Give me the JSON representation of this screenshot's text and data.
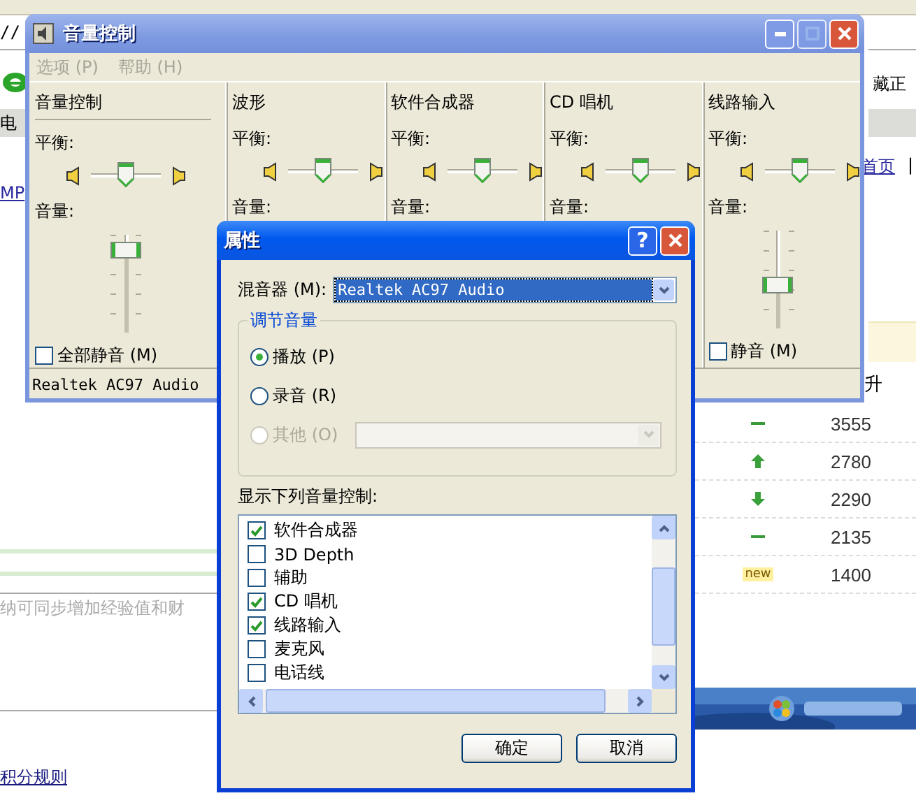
{
  "background_page": {
    "address_fragment": "//",
    "left_tab_fragment": "电",
    "left_link_fragment": "MP",
    "right_toolbar_fragment": "藏正",
    "right_link_fragment": "首页",
    "right_separator": "|",
    "column_fragment": "升",
    "rank_rows": [
      {
        "kind": "flat",
        "value": "3555"
      },
      {
        "kind": "up",
        "value": "2780"
      },
      {
        "kind": "down",
        "value": "2290"
      },
      {
        "kind": "flat",
        "value": "2135"
      },
      {
        "kind": "badge",
        "badge": "new",
        "value": "1400"
      }
    ],
    "hint_fragment": "纳可同步增加经验值和财",
    "rules_link": "积分规则"
  },
  "volume_window": {
    "title": "音量控制",
    "menu": [
      {
        "label": "选项 (P)",
        "disabled": true
      },
      {
        "label": "帮助 (H)",
        "disabled": true
      }
    ],
    "columns": [
      {
        "name": "音量控制",
        "balance": {
          "label": "平衡:",
          "level": 0.5
        },
        "volume": {
          "label": "音量:",
          "level": 0.85
        },
        "mute": {
          "label": "全部静音 (M)",
          "checked": false
        }
      },
      {
        "name": "波形",
        "balance": {
          "label": "平衡:",
          "level": 0.5
        },
        "volume": {
          "label": "音量:"
        }
      },
      {
        "name": "软件合成器",
        "balance": {
          "label": "平衡:",
          "level": 0.5
        },
        "volume": {
          "label": "音量:"
        }
      },
      {
        "name": "CD 唱机",
        "balance": {
          "label": "平衡:",
          "level": 0.5
        },
        "volume": {
          "label": "音量:"
        }
      },
      {
        "name": "线路输入",
        "balance": {
          "label": "平衡:",
          "level": 0.5
        },
        "volume": {
          "label": "音量:",
          "level": 0.45
        },
        "mute": {
          "label": "静音 (M)",
          "checked": false
        }
      }
    ],
    "status": "Realtek AC97 Audio"
  },
  "properties_dialog": {
    "title": "属性",
    "help_button": "?",
    "mixer_label": "混音器 (M):",
    "mixer_value": "Realtek AC97 Audio",
    "group_title": "调节音量",
    "radios": [
      {
        "label": "播放 (P)",
        "selected": true,
        "disabled": false
      },
      {
        "label": "录音 (R)",
        "selected": false,
        "disabled": false
      },
      {
        "label": "其他 (O)",
        "selected": false,
        "disabled": true
      }
    ],
    "list_label": "显示下列音量控制:",
    "controls": [
      {
        "label": "软件合成器",
        "checked": true
      },
      {
        "label": "3D Depth",
        "checked": false
      },
      {
        "label": "辅助",
        "checked": false
      },
      {
        "label": "CD 唱机",
        "checked": true
      },
      {
        "label": "线路输入",
        "checked": true
      },
      {
        "label": "麦克风",
        "checked": false
      },
      {
        "label": "电话线",
        "checked": false
      }
    ],
    "buttons": [
      "确定",
      "取消"
    ]
  }
}
